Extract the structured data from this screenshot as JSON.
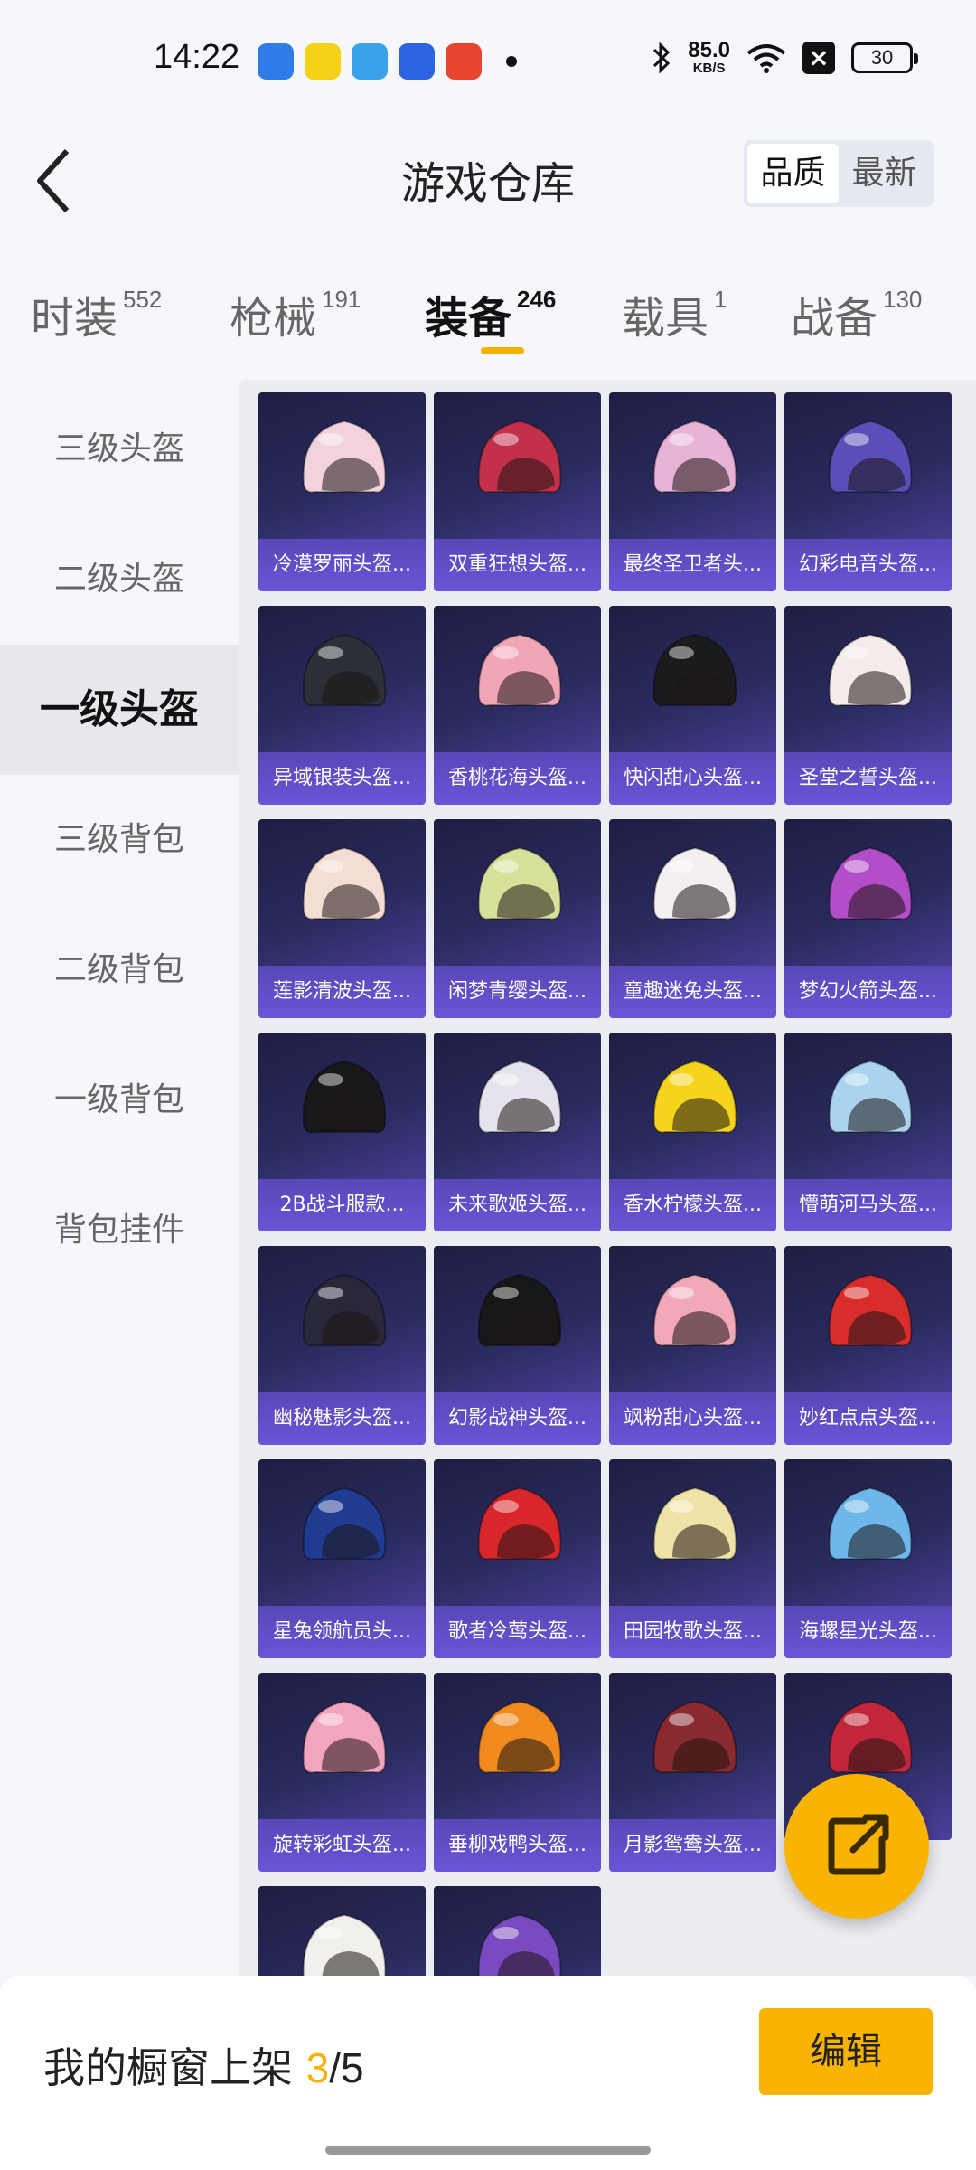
{
  "status_bar": {
    "time": "14:22",
    "net_speed_value": "85.0",
    "net_speed_unit": "KB/S",
    "battery": "30"
  },
  "header": {
    "title": "游戏仓库",
    "sort_options": [
      "品质",
      "最新"
    ],
    "active_sort": "品质"
  },
  "tabs": [
    {
      "label": "时装",
      "count": "552"
    },
    {
      "label": "枪械",
      "count": "191"
    },
    {
      "label": "装备",
      "count": "246",
      "active": true
    },
    {
      "label": "载具",
      "count": "1"
    },
    {
      "label": "战备",
      "count": "130"
    }
  ],
  "sidebar": {
    "items": [
      "三级头盔",
      "二级头盔",
      "一级头盔",
      "三级背包",
      "二级背包",
      "一级背包",
      "背包挂件"
    ],
    "active": "一级头盔"
  },
  "items": [
    {
      "name": "冷漠罗丽头盔...",
      "color": "#f2d3dc"
    },
    {
      "name": "双重狂想头盔...",
      "color": "#c2304a"
    },
    {
      "name": "最终圣卫者头...",
      "color": "#e7b3d7"
    },
    {
      "name": "幻彩电音头盔...",
      "color": "#5a4fb8"
    },
    {
      "name": "异域银装头盔...",
      "color": "#2c2f36"
    },
    {
      "name": "香桃花海头盔...",
      "color": "#f1a6b8"
    },
    {
      "name": "快闪甜心头盔...",
      "color": "#1b1b1e"
    },
    {
      "name": "圣堂之誓头盔...",
      "color": "#f3ece9"
    },
    {
      "name": "莲影清波头盔...",
      "color": "#f4ddd3"
    },
    {
      "name": "闲梦青缨头盔...",
      "color": "#d7e19a"
    },
    {
      "name": "童趣迷兔头盔...",
      "color": "#f4f0f2"
    },
    {
      "name": "梦幻火箭头盔...",
      "color": "#b24ec8"
    },
    {
      "name": "2B战斗服款...",
      "color": "#18181b"
    },
    {
      "name": "未来歌姬头盔...",
      "color": "#e6e3ec"
    },
    {
      "name": "香水柠檬头盔...",
      "color": "#f4d41c"
    },
    {
      "name": "懵萌河马头盔...",
      "color": "#a9d3ee"
    },
    {
      "name": "幽秘魅影头盔...",
      "color": "#28283a"
    },
    {
      "name": "幻影战神头盔...",
      "color": "#17171a"
    },
    {
      "name": "飒粉甜心头盔...",
      "color": "#f1a9b9"
    },
    {
      "name": "妙红点点头盔...",
      "color": "#d82d2b"
    },
    {
      "name": "星兔领航员头...",
      "color": "#1f3c92"
    },
    {
      "name": "歌者冷莺头盔...",
      "color": "#d9262a"
    },
    {
      "name": "田园牧歌头盔...",
      "color": "#f0e3a8"
    },
    {
      "name": "海螺星光头盔...",
      "color": "#6db7ea"
    },
    {
      "name": "旋转彩虹头盔...",
      "color": "#f3a5bf"
    },
    {
      "name": "垂柳戏鸭头盔...",
      "color": "#f08a1f"
    },
    {
      "name": "月影鸳鸯头盔...",
      "color": "#8a2a2e"
    },
    {
      "name": "",
      "color": "#c2263a"
    },
    {
      "name": "",
      "color": "#f2f0ea"
    },
    {
      "name": "",
      "color": "#7a4bc0"
    }
  ],
  "bottom": {
    "showcase_label": "我的橱窗上架",
    "showcase_current": "3",
    "showcase_total": "/5",
    "edit_label": "编辑"
  },
  "fab_icon": "share-icon",
  "accent_color": "#f8b400"
}
